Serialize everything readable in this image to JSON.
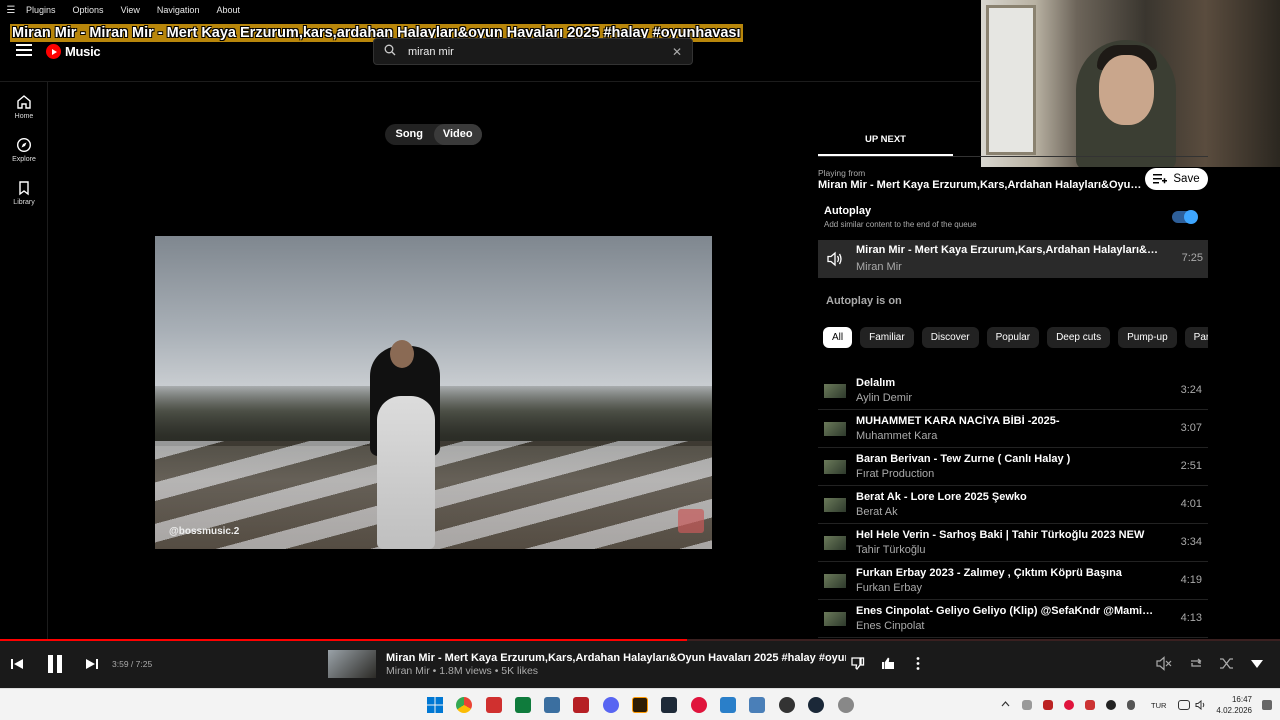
{
  "menubar": {
    "items": [
      "Plugins",
      "Options",
      "View",
      "Navigation",
      "About"
    ]
  },
  "overlay_title": "Miran Mir - Miran Mir - Mert Kaya Erzurum,kars,ardahan Halayları&oyun Havaları 2025 #halay #oyunhavası",
  "header": {
    "logo_text": "Music",
    "search_value": "miran mir"
  },
  "nav": {
    "items": [
      {
        "label": "Home",
        "icon": "home-icon"
      },
      {
        "label": "Explore",
        "icon": "compass-icon"
      },
      {
        "label": "Library",
        "icon": "bookmark-icon"
      }
    ]
  },
  "toggle": {
    "song": "Song",
    "video": "Video",
    "selected": "Video"
  },
  "video": {
    "watermark": "@bossmusic.2"
  },
  "right_panel": {
    "tab": "UP NEXT",
    "playing_from_label": "Playing from",
    "playing_from_title": "Miran Mir - Mert Kaya Erzurum,Kars,Ardahan Halayları&Oyun Havaları 2025 #halay #oyunhavası",
    "save_label": "Save",
    "autoplay_title": "Autoplay",
    "autoplay_sub": "Add similar content to the end of the queue",
    "autoplay_enabled": true,
    "current": {
      "title": "Miran Mir - Mert Kaya Erzurum,Kars,Ardahan Halayları&Oyun Havaları 2025 #halay #oyunhavası",
      "artist": "Miran Mir",
      "duration": "7:25"
    },
    "autoplay_on": "Autoplay is on",
    "chips": [
      "All",
      "Familiar",
      "Discover",
      "Popular",
      "Deep cuts",
      "Pump-up",
      "Party"
    ],
    "queue": [
      {
        "title": "Delalım",
        "artist": "Aylin Demir",
        "duration": "3:24"
      },
      {
        "title": "MUHAMMET KARA NACİYA BİBİ -2025-",
        "artist": "Muhammet Kara",
        "duration": "3:07"
      },
      {
        "title": "Baran Berivan - Tew Zurne ( Canlı Halay )",
        "artist": "Fırat Production",
        "duration": "2:51"
      },
      {
        "title": "Berat Ak - Lore Lore 2025 Şewko",
        "artist": "Berat Ak",
        "duration": "4:01"
      },
      {
        "title": "Hel Hele Verin - Sarhoş Baki | Tahir Türkoğlu 2023 NEW",
        "artist": "Tahir Türkoğlu",
        "duration": "3:34"
      },
      {
        "title": "Furkan Erbay 2023 - Zalımey , Çıktım Köprü Başına",
        "artist": "Furkan Erbay",
        "duration": "4:19"
      },
      {
        "title": "Enes Cinpolat- Geliyo Geliyo (Klip) @SefaKndr @MamiEmen",
        "artist": "Enes Cinpolat",
        "duration": "4:13"
      }
    ]
  },
  "player": {
    "time": "3:59 / 7:25",
    "progress_fraction": 0.537,
    "title": "Miran Mir - Mert Kaya Erzurum,Kars,Ardahan Halayları&Oyun Havaları 2025 #halay #oyunhavası",
    "subtitle": "Miran Mir • 1.8M views • 5K likes"
  },
  "taskbar": {
    "lang": "TUR",
    "time": "16:47",
    "date": "4.02.2026",
    "accent": "#0078d4"
  }
}
